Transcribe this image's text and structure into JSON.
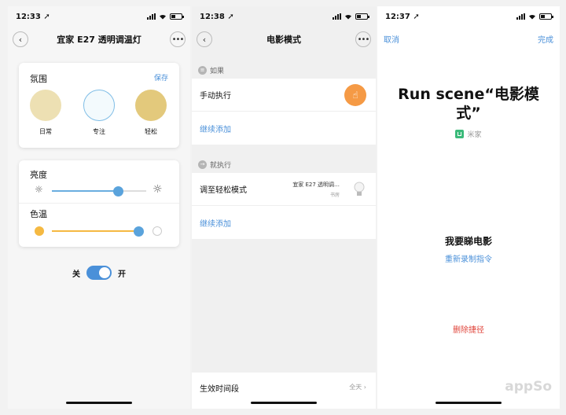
{
  "colors": {
    "accent": "#4a90d9",
    "orange": "#f59a45",
    "danger": "#e0463c",
    "amber": "#f5b942"
  },
  "phone1": {
    "status": {
      "time": "12:33"
    },
    "nav": {
      "title": "宜家 E27 透明调温灯"
    },
    "ambience": {
      "title": "氛围",
      "save": "保存",
      "scenes": [
        {
          "label": "日常",
          "color": "#ede0b3"
        },
        {
          "label": "专注",
          "color": "#f3fafd"
        },
        {
          "label": "轻松",
          "color": "#e3c97c"
        }
      ]
    },
    "brightness": {
      "title": "亮度",
      "value_percent": 0.7
    },
    "color_temp": {
      "title": "色温",
      "value_percent": 1.0
    },
    "power": {
      "off": "关",
      "on": "开"
    }
  },
  "phone2": {
    "status": {
      "time": "12:38"
    },
    "nav": {
      "title": "电影模式"
    },
    "if_section": {
      "header": "如果",
      "row": "手动执行",
      "add": "继续添加"
    },
    "then_section": {
      "header": "就执行",
      "row": "调至轻松模式",
      "device_name": "宜家 E27 透明调…",
      "device_room": "书房",
      "add": "继续添加"
    },
    "effective": {
      "label": "生效时间段",
      "value": "全天"
    }
  },
  "phone3": {
    "status": {
      "time": "12:37"
    },
    "nav": {
      "cancel": "取消",
      "done": "完成"
    },
    "title": "Run scene“电影模式”",
    "app": "米家",
    "phrase": "我要睇电影",
    "rerecord": "重新录制指令",
    "delete": "删除捷径"
  },
  "watermark": "appSo",
  "icons": [
    "chevron-left-icon",
    "more-icon",
    "sun-low-icon",
    "sun-high-icon",
    "hand-tap-icon",
    "bulb-icon",
    "list-icon",
    "arrow-right-icon",
    "signal-icon",
    "wifi-icon",
    "battery-icon",
    "location-icon",
    "mijia-icon"
  ]
}
